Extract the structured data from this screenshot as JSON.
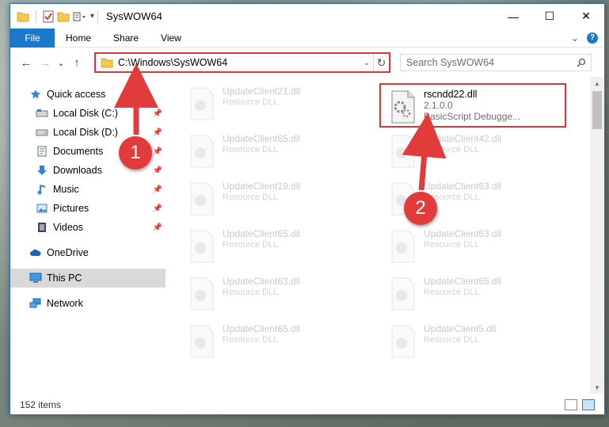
{
  "window": {
    "title": "SysWOW64",
    "minimize": "—",
    "maximize": "☐",
    "close": "✕"
  },
  "ribbon": {
    "tabs": [
      {
        "label": "File"
      },
      {
        "label": "Home"
      },
      {
        "label": "Share"
      },
      {
        "label": "View"
      }
    ],
    "expand": "⌄",
    "help": "?"
  },
  "nav": {
    "back": "←",
    "forward": "→",
    "recent": "⌄",
    "up": "↑",
    "address": "C:\\Windows\\SysWOW64",
    "address_dropdown": "⌄",
    "refresh": "↻"
  },
  "search": {
    "placeholder": "Search SysWOW64"
  },
  "sidebar": {
    "items": [
      {
        "label": "Quick access",
        "icon": "star-icon",
        "pinned": false
      },
      {
        "label": "Local Disk (C:)",
        "icon": "drive-icon",
        "pinned": true
      },
      {
        "label": "Local Disk (D:)",
        "icon": "drive-icon",
        "pinned": true
      },
      {
        "label": "Documents",
        "icon": "documents-icon",
        "pinned": true
      },
      {
        "label": "Downloads",
        "icon": "download-icon",
        "pinned": true
      },
      {
        "label": "Music",
        "icon": "music-icon",
        "pinned": true
      },
      {
        "label": "Pictures",
        "icon": "pictures-icon",
        "pinned": true
      },
      {
        "label": "Videos",
        "icon": "videos-icon",
        "pinned": true
      },
      {
        "label": "OneDrive",
        "icon": "cloud-icon",
        "pinned": false
      },
      {
        "label": "This PC",
        "icon": "computer-icon",
        "pinned": false
      },
      {
        "label": "Network",
        "icon": "network-icon",
        "pinned": false
      }
    ],
    "pin_glyph": "📌"
  },
  "files": {
    "highlight": {
      "name": "rscndd22.dll",
      "version": "2.1.0.0",
      "desc": "BasicScript Debugge..."
    },
    "left_column": [
      {
        "name": "UpdateClient21.dll",
        "type": "Resource DLL"
      },
      {
        "name": "UpdateClient65.dll",
        "type": "Resource DLL"
      },
      {
        "name": "UpdateClient19.dll",
        "type": "Resource DLL"
      },
      {
        "name": "UpdateClient65.dll",
        "type": "Resource DLL"
      },
      {
        "name": "UpdateClient63.dll",
        "type": "Resource DLL"
      },
      {
        "name": "UpdateClient65.dll",
        "type": "Resource DLL"
      }
    ],
    "right_column": [
      {
        "name": "UpdateClient42.dll",
        "type": "Resource DLL"
      },
      {
        "name": "UpdateClient63.dll",
        "type": "Resource DLL"
      },
      {
        "name": "UpdateClient63.dll",
        "type": "Resource DLL"
      },
      {
        "name": "UpdateClient65.dll",
        "type": "Resource DLL"
      },
      {
        "name": "UpdateClient5.dll",
        "type": "Resource DLL"
      }
    ]
  },
  "status": {
    "count": "152 items"
  },
  "annotations": {
    "step1": "1",
    "step2": "2",
    "color": "#e23b3b"
  }
}
